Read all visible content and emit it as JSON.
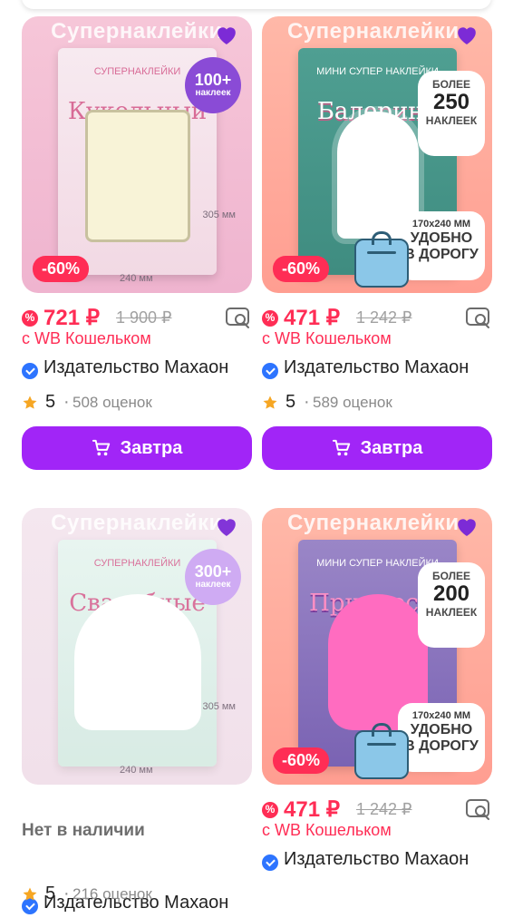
{
  "products": [
    {
      "banner": "Супернаклейки",
      "book_small": "СУПЕРНАКЛЕЙКИ",
      "book_title": "Кукольный домик",
      "badge_big": "100+",
      "badge_small": "наклеек",
      "dim_vertical": "305 мм",
      "dim_horizontal": "240 мм",
      "discount": "-60%",
      "price": "721 ₽",
      "old_price": "1 900 ₽",
      "wallet": "с WB Кошельком",
      "seller": "Издательство Махаон",
      "rating": "5",
      "reviews": "508 оценок",
      "buy_label": "Завтра"
    },
    {
      "banner": "Супернаклейки-мини",
      "book_small": "МИНИ СУПЕР НАКЛЕЙКИ",
      "book_title": "Балерина",
      "badge_line1": "БОЛЕЕ",
      "badge_line2": "250",
      "badge_line3": "НАКЛЕЕК",
      "size_line1": "170x240 ММ",
      "size_line2": "УДОБНО",
      "size_line3": "В ДОРОГУ",
      "discount": "-60%",
      "price": "471 ₽",
      "old_price": "1 242 ₽",
      "wallet": "с WB Кошельком",
      "seller": "Издательство Махаон",
      "rating": "5",
      "reviews": "589 оценок",
      "buy_label": "Завтра"
    },
    {
      "banner": "Супернаклейки",
      "book_small": "СУПЕРНАКЛЕЙКИ",
      "book_title": "Свадебные платья",
      "badge_big": "300+",
      "badge_small": "наклеек",
      "dim_vertical": "305 мм",
      "dim_horizontal": "240 мм",
      "stock": "Нет в наличии",
      "seller": "Издательство Махаон",
      "rating": "5",
      "reviews": "216 оценок"
    },
    {
      "banner": "Супернаклейки-мини",
      "book_small": "МИНИ СУПЕР НАКЛЕЙКИ",
      "book_title": "Принцесса",
      "badge_line1": "БОЛЕЕ",
      "badge_line2": "200",
      "badge_line3": "НАКЛЕЕК",
      "size_line1": "170x240 ММ",
      "size_line2": "УДОБНО",
      "size_line3": "В ДОРОГУ",
      "discount": "-60%",
      "price": "471 ₽",
      "old_price": "1 242 ₽",
      "wallet": "с WB Кошельком",
      "seller": "Издательство Махаон"
    }
  ],
  "colors": {
    "accent": "#a125f7",
    "sale": "#ff2d55",
    "verified": "#2d74ff"
  }
}
